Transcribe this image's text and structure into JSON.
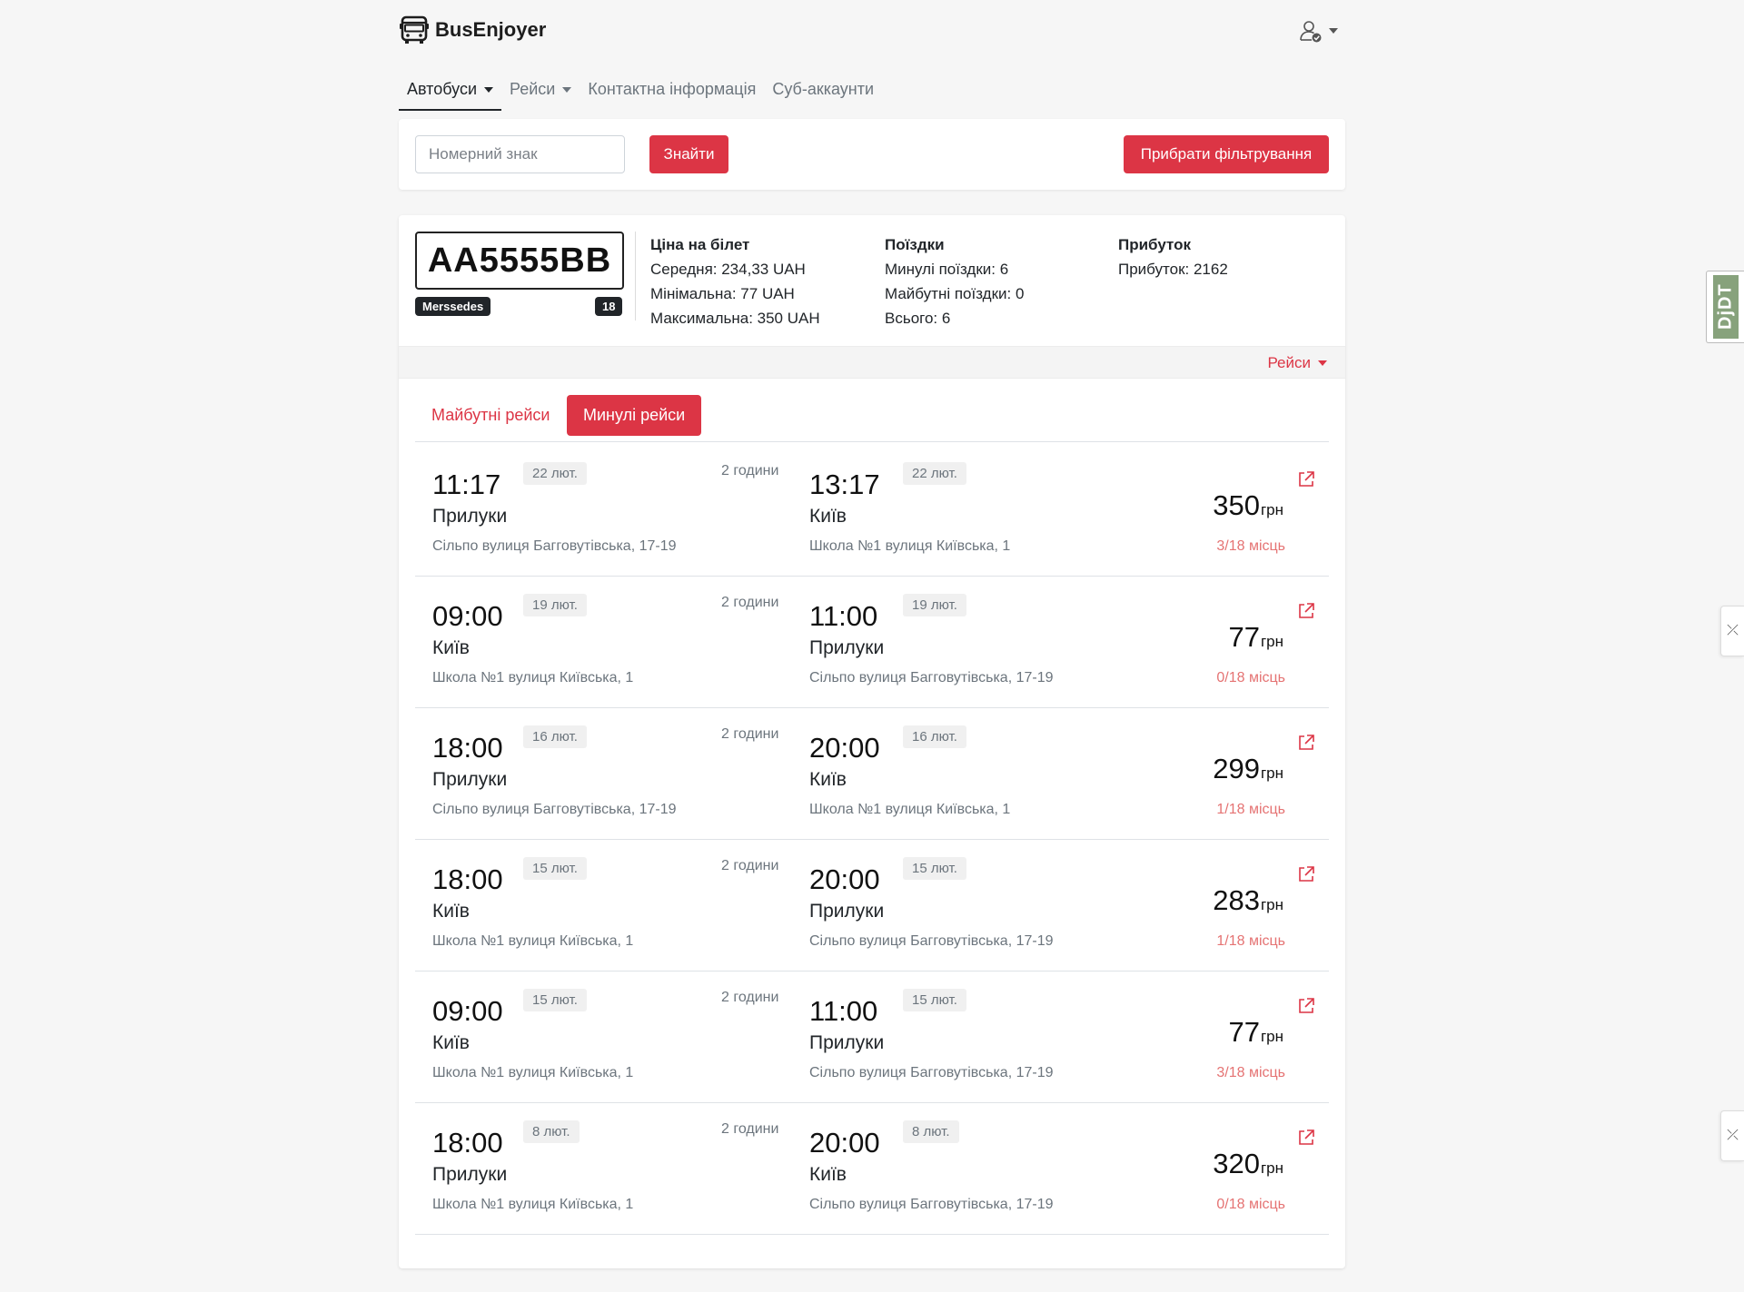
{
  "brand": {
    "name": "BusEnjoyer"
  },
  "nav": {
    "items": [
      {
        "label": "Автобуси",
        "dropdown": true,
        "active": true
      },
      {
        "label": "Рейси",
        "dropdown": true,
        "active": false
      },
      {
        "label": "Контактна інформація",
        "dropdown": false,
        "active": false
      },
      {
        "label": "Суб-аккаунти",
        "dropdown": false,
        "active": false
      }
    ]
  },
  "search": {
    "placeholder": "Номерний знак",
    "value": "",
    "find_label": "Знайти",
    "clear_label": "Прибрати фільтрування"
  },
  "bus": {
    "plate": "AA5555BB",
    "model": "Merssedes",
    "seats": "18"
  },
  "stats": {
    "price": {
      "title": "Ціна на білет",
      "lines": [
        "Середня: 234,33 UAH",
        "Мінімальна: 77 UAH",
        "Максимальна: 350 UAH"
      ]
    },
    "trips": {
      "title": "Поїздки",
      "lines": [
        "Минулі поїздки: 6",
        "Майбутні поїздки: 0",
        "Всього: 6"
      ]
    },
    "profit": {
      "title": "Прибуток",
      "lines": [
        "Прибуток: 2162"
      ]
    }
  },
  "card_bar": {
    "trips_label": "Рейси"
  },
  "tabs": {
    "future": "Майбутні рейси",
    "past": "Минулі рейси"
  },
  "trips": [
    {
      "dep_time": "11:17",
      "dep_date": "22 лют.",
      "dep_city": "Прилуки",
      "dep_addr": "Сільпо вулиця Багговутівська, 17-19",
      "duration": "2 години",
      "arr_time": "13:17",
      "arr_date": "22 лют.",
      "arr_city": "Київ",
      "arr_addr": "Школа №1 вулиця Київська, 1",
      "price": "350",
      "currency": "грн",
      "seats": "3/18 місць"
    },
    {
      "dep_time": "09:00",
      "dep_date": "19 лют.",
      "dep_city": "Київ",
      "dep_addr": "Школа №1 вулиця Київська, 1",
      "duration": "2 години",
      "arr_time": "11:00",
      "arr_date": "19 лют.",
      "arr_city": "Прилуки",
      "arr_addr": "Сільпо вулиця Багговутівська, 17-19",
      "price": "77",
      "currency": "грн",
      "seats": "0/18 місць"
    },
    {
      "dep_time": "18:00",
      "dep_date": "16 лют.",
      "dep_city": "Прилуки",
      "dep_addr": "Сільпо вулиця Багговутівська, 17-19",
      "duration": "2 години",
      "arr_time": "20:00",
      "arr_date": "16 лют.",
      "arr_city": "Київ",
      "arr_addr": "Школа №1 вулиця Київська, 1",
      "price": "299",
      "currency": "грн",
      "seats": "1/18 місць"
    },
    {
      "dep_time": "18:00",
      "dep_date": "15 лют.",
      "dep_city": "Київ",
      "dep_addr": "Школа №1 вулиця Київська, 1",
      "duration": "2 години",
      "arr_time": "20:00",
      "arr_date": "15 лют.",
      "arr_city": "Прилуки",
      "arr_addr": "Сільпо вулиця Багговутівська, 17-19",
      "price": "283",
      "currency": "грн",
      "seats": "1/18 місць"
    },
    {
      "dep_time": "09:00",
      "dep_date": "15 лют.",
      "dep_city": "Київ",
      "dep_addr": "Школа №1 вулиця Київська, 1",
      "duration": "2 години",
      "arr_time": "11:00",
      "arr_date": "15 лют.",
      "arr_city": "Прилуки",
      "arr_addr": "Сільпо вулиця Багговутівська, 17-19",
      "price": "77",
      "currency": "грн",
      "seats": "3/18 місць"
    },
    {
      "dep_time": "18:00",
      "dep_date": "8 лют.",
      "dep_city": "Прилуки",
      "dep_addr": "Школа №1 вулиця Київська, 1",
      "duration": "2 години",
      "arr_time": "20:00",
      "arr_date": "8 лют.",
      "arr_city": "Київ",
      "arr_addr": "Сільпо вулиця Багговутівська, 17-19",
      "price": "320",
      "currency": "грн",
      "seats": "0/18 місць"
    }
  ],
  "debug_toolbar": {
    "label": "DjDT"
  },
  "icons": {
    "brand": "bus-icon",
    "user": "user-check-icon",
    "external": "external-link-icon",
    "side": "collapse-arrows-icon"
  },
  "colors": {
    "accent": "#dc3545",
    "seats": "#e57373"
  }
}
